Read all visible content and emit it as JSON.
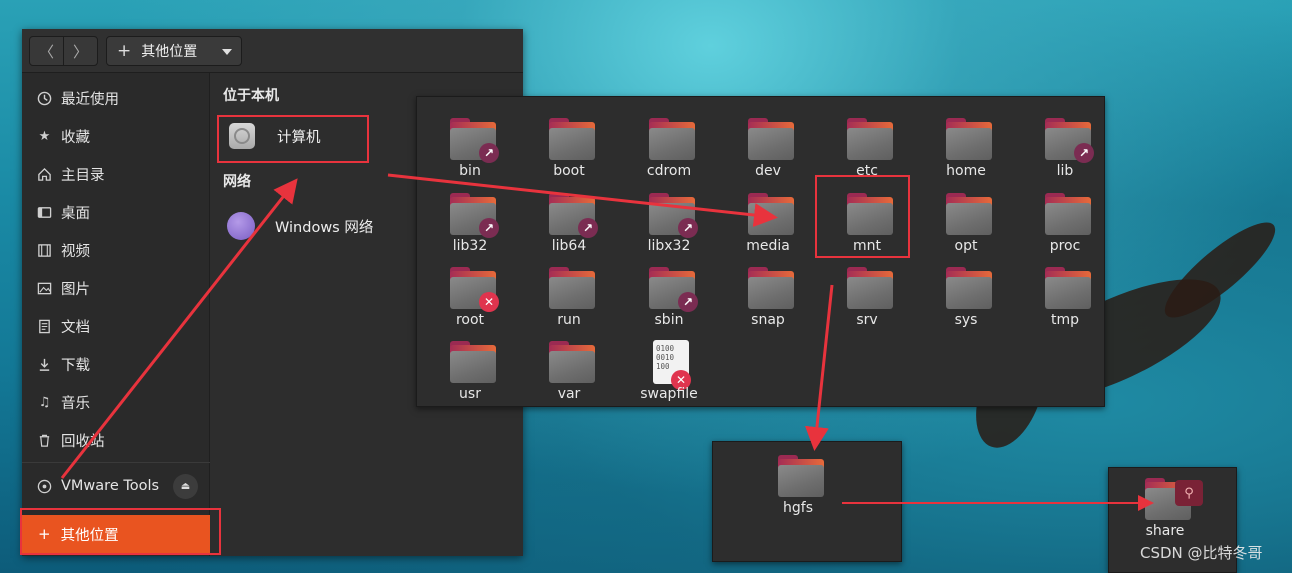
{
  "header": {
    "back_label": "〈",
    "forward_label": "〉",
    "path_plus": "+",
    "path_label": "其他位置"
  },
  "sidebar": {
    "items": [
      {
        "label": "最近使用",
        "icon": "clock-icon"
      },
      {
        "label": "收藏",
        "icon": "star-icon"
      },
      {
        "label": "主目录",
        "icon": "home-icon"
      },
      {
        "label": "桌面",
        "icon": "desktop-icon"
      },
      {
        "label": "视频",
        "icon": "video-icon"
      },
      {
        "label": "图片",
        "icon": "picture-icon"
      },
      {
        "label": "文档",
        "icon": "document-icon"
      },
      {
        "label": "下载",
        "icon": "download-icon"
      },
      {
        "label": "音乐",
        "icon": "music-icon"
      },
      {
        "label": "回收站",
        "icon": "trash-icon"
      }
    ],
    "device": {
      "label": "VMware Tools",
      "icon": "disc-icon"
    },
    "other_locations": {
      "plus": "+",
      "label": "其他位置"
    }
  },
  "main": {
    "on_this_computer": "位于本机",
    "computer_label": "计算机",
    "networks": "网络",
    "windows_network": "Windows 网络"
  },
  "folders": [
    {
      "name": "bin",
      "emblem": "link"
    },
    {
      "name": "boot",
      "emblem": ""
    },
    {
      "name": "cdrom",
      "emblem": ""
    },
    {
      "name": "dev",
      "emblem": ""
    },
    {
      "name": "etc",
      "emblem": ""
    },
    {
      "name": "home",
      "emblem": ""
    },
    {
      "name": "lib",
      "emblem": "link"
    },
    {
      "name": "lib32",
      "emblem": "link"
    },
    {
      "name": "lib64",
      "emblem": "link"
    },
    {
      "name": "libx32",
      "emblem": "link"
    },
    {
      "name": "media",
      "emblem": ""
    },
    {
      "name": "mnt",
      "emblem": ""
    },
    {
      "name": "opt",
      "emblem": ""
    },
    {
      "name": "proc",
      "emblem": ""
    },
    {
      "name": "root",
      "emblem": "lock"
    },
    {
      "name": "run",
      "emblem": ""
    },
    {
      "name": "sbin",
      "emblem": "link"
    },
    {
      "name": "snap",
      "emblem": ""
    },
    {
      "name": "srv",
      "emblem": ""
    },
    {
      "name": "sys",
      "emblem": ""
    },
    {
      "name": "tmp",
      "emblem": ""
    },
    {
      "name": "usr",
      "emblem": ""
    },
    {
      "name": "var",
      "emblem": ""
    }
  ],
  "swapfile": {
    "name": "swapfile",
    "bits": "0100\n0010\n100"
  },
  "hgfs_window": {
    "name": "hgfs"
  },
  "share_window": {
    "name": "share"
  },
  "emblem_glyphs": {
    "link": "↗",
    "lock": "✕"
  },
  "watermark": "CSDN @比特冬哥",
  "colors": {
    "accent": "#e95420",
    "annotation": "#e8333d"
  }
}
